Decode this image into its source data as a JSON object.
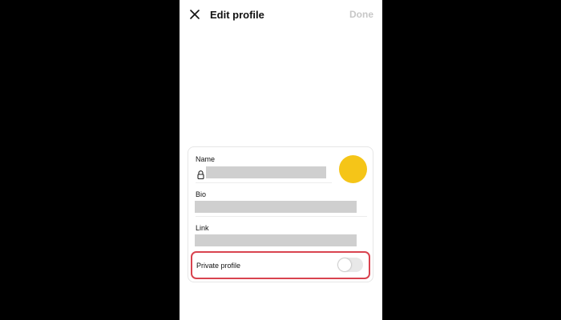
{
  "header": {
    "title": "Edit profile",
    "done_label": "Done",
    "close_icon": "close-icon"
  },
  "profile": {
    "name_label": "Name",
    "bio_label": "Bio",
    "link_label": "Link",
    "private_label": "Private profile",
    "private_enabled": false,
    "lock_icon": "lock-icon",
    "avatar_color": "#f5c518",
    "highlight_color": "#d9434f"
  }
}
